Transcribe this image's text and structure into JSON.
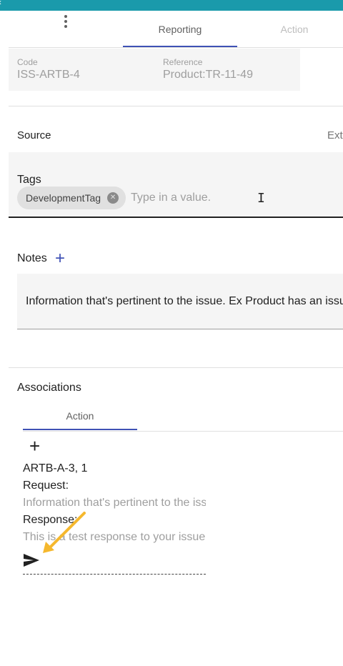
{
  "tabs": {
    "reporting": "Reporting",
    "action": "Action"
  },
  "info": {
    "code_label": "Code",
    "code_value": "ISS-ARTB-4",
    "reference_label": "Reference",
    "reference_value": "Product:TR-11-49"
  },
  "source": {
    "label": "Source",
    "ext_label": "Exte"
  },
  "tags": {
    "label": "Tags",
    "chips": [
      "DevelopmentTag"
    ],
    "input_placeholder": "Type in a value."
  },
  "notes": {
    "label": "Notes",
    "add_icon": "+",
    "text": "Information that's pertinent to the issue. Ex Product has an issue"
  },
  "associations": {
    "label": "Associations",
    "tab": "Action",
    "add_icon": "+",
    "item_title": "ARTB-A-3, 1",
    "request_label": "Request:",
    "request_text": "Information that's pertinent to the issue",
    "response_label": "Response:",
    "response_text": "This is a test response to your issue"
  },
  "colors": {
    "header": "#1a9aab",
    "accent": "#3f51b5",
    "annotation_arrow": "#f5b82e"
  },
  "icons": {
    "more": "more-vert-icon",
    "chip_remove": "cancel-circle-icon",
    "send": "send-icon",
    "cursor": "text-cursor-icon"
  }
}
